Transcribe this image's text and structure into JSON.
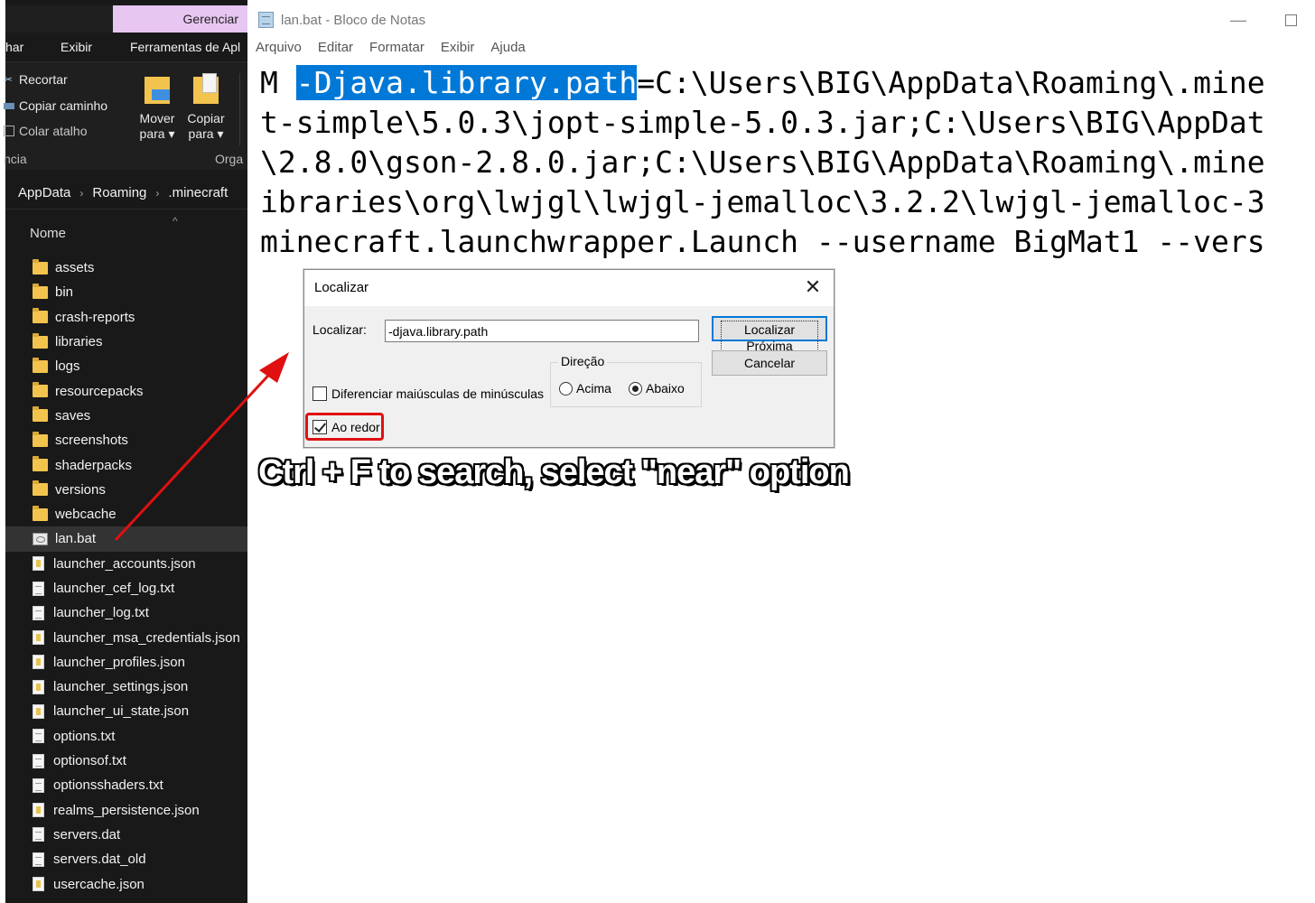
{
  "explorer": {
    "context_tab": "Gerenciar",
    "ribbon_tabs": [
      "har",
      "Exibir",
      "Ferramentas de Apl"
    ],
    "clipboard": [
      "Recortar",
      "Copiar caminho",
      "Colar atalho"
    ],
    "move_button": "Mover para ▾",
    "copy_button": "Copiar para ▾",
    "group_left": "ncia",
    "group_right": "Orga",
    "breadcrumb": [
      "AppData",
      "Roaming",
      ".minecraft"
    ],
    "column_name": "Nome",
    "folders": [
      "assets",
      "bin",
      "crash-reports",
      "libraries",
      "logs",
      "resourcepacks",
      "saves",
      "screenshots",
      "shaderpacks",
      "versions",
      "webcache"
    ],
    "selected_file": "lan.bat",
    "files": [
      {
        "name": "launcher_accounts.json",
        "icon": "json-file-icon"
      },
      {
        "name": "launcher_cef_log.txt",
        "icon": "text-file-icon"
      },
      {
        "name": "launcher_log.txt",
        "icon": "text-file-icon"
      },
      {
        "name": "launcher_msa_credentials.json",
        "icon": "json-file-icon"
      },
      {
        "name": "launcher_profiles.json",
        "icon": "json-file-icon"
      },
      {
        "name": "launcher_settings.json",
        "icon": "json-file-icon"
      },
      {
        "name": "launcher_ui_state.json",
        "icon": "json-file-icon"
      },
      {
        "name": "options.txt",
        "icon": "text-file-icon"
      },
      {
        "name": "optionsof.txt",
        "icon": "text-file-icon"
      },
      {
        "name": "optionsshaders.txt",
        "icon": "text-file-icon"
      },
      {
        "name": "realms_persistence.json",
        "icon": "json-file-icon"
      },
      {
        "name": "servers.dat",
        "icon": "file-icon"
      },
      {
        "name": "servers.dat_old",
        "icon": "file-icon"
      },
      {
        "name": "usercache.json",
        "icon": "json-file-icon"
      }
    ]
  },
  "notepad": {
    "title": "lan.bat - Bloco de Notas",
    "menu": [
      "Arquivo",
      "Editar",
      "Formatar",
      "Exibir",
      "Ajuda"
    ],
    "line1_prefix": "M ",
    "line1_highlight": "-Djava.library.path",
    "line1_suffix": "=C:\\Users\\BIG\\AppData\\Roaming\\.mine",
    "lines": [
      "t-simple\\5.0.3\\jopt-simple-5.0.3.jar;C:\\Users\\BIG\\AppDat",
      "\\2.8.0\\gson-2.8.0.jar;C:\\Users\\BIG\\AppData\\Roaming\\.mine",
      "ibraries\\org\\lwjgl\\lwjgl-jemalloc\\3.2.2\\lwjgl-jemalloc-3",
      "minecraft.launchwrapper.Launch --username BigMat1 --vers"
    ]
  },
  "find_dialog": {
    "title": "Localizar",
    "label": "Localizar:",
    "value": "-djava.library.path",
    "find_next": "Localizar Próxima",
    "cancel": "Cancelar",
    "direction_label": "Direção",
    "dir_up": "Acima",
    "dir_down": "Abaixo",
    "match_case": "Diferenciar maiúsculas de minúsculas",
    "wrap_around": "Ao redor"
  },
  "annotation": "Ctrl + F to search, select \"near\" option",
  "colors": {
    "highlight": "#0078d7",
    "annotation_red": "#e01010",
    "explorer_bg": "#191919"
  }
}
